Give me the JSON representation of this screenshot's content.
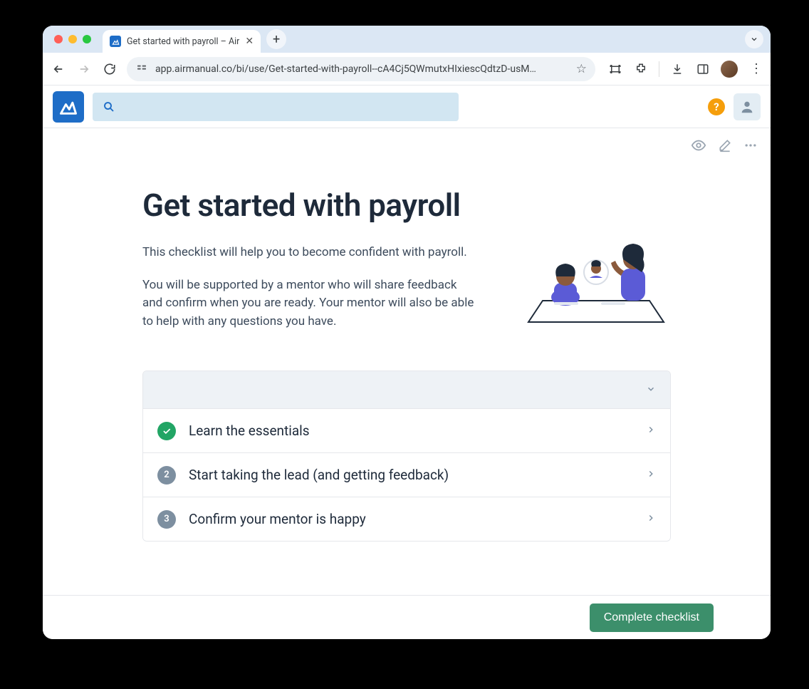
{
  "browser": {
    "tab_title": "Get started with payroll – Air",
    "url": "app.airmanual.co/bi/use/Get-started-with-payroll--cA4Cj5QWmutxHIxiescQdtzD-usM…"
  },
  "app": {
    "help_label": "?"
  },
  "page": {
    "title": "Get started with payroll",
    "intro1": "This checklist will help you to become confident with payroll.",
    "intro2": "You will be supported by a mentor who will share feedback and confirm when you are ready. Your mentor will also be able to help with any questions you have."
  },
  "checklist": {
    "items": [
      {
        "badge": "✓",
        "label": "Learn the essentials",
        "done": true
      },
      {
        "badge": "2",
        "label": "Start taking the lead (and getting feedback)",
        "done": false
      },
      {
        "badge": "3",
        "label": "Confirm your mentor is happy",
        "done": false
      }
    ]
  },
  "footer": {
    "complete_label": "Complete checklist"
  }
}
